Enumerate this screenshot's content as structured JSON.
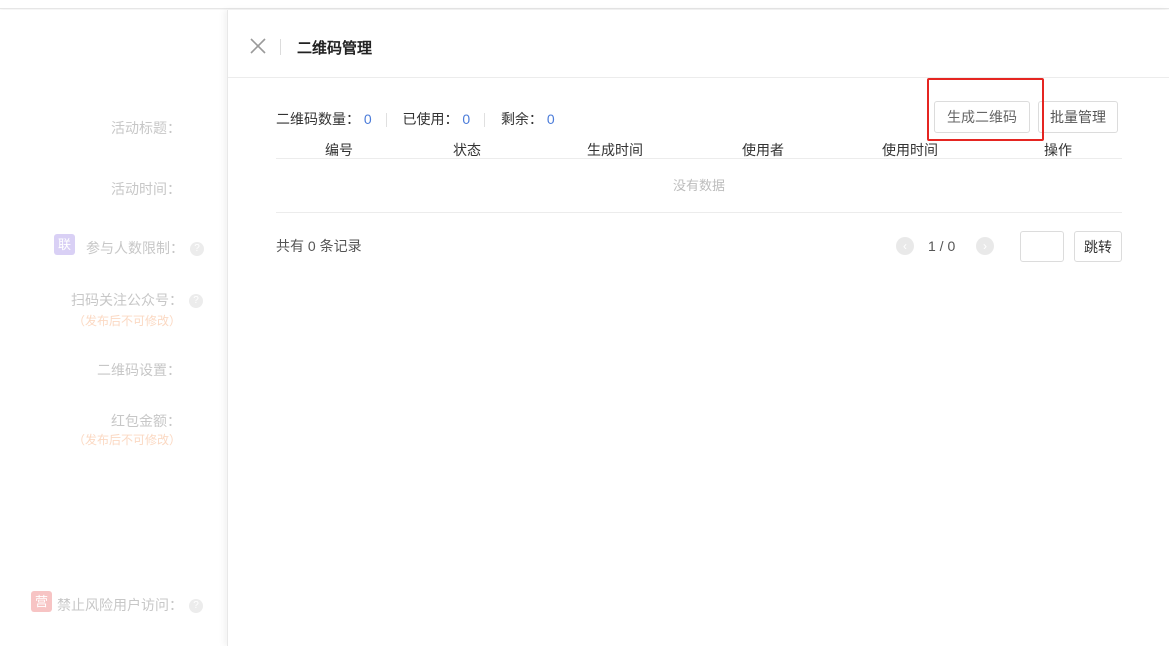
{
  "form": {
    "activity_title": "活动标题：",
    "activity_time": "活动时间：",
    "participant_limit": "参与人数限制：",
    "participant_badge": "联",
    "scan_follow": "扫码关注公众号：",
    "scan_follow_note": "（发布后不可修改）",
    "qr_settings": "二维码设置：",
    "red_packet": "红包金额：",
    "red_packet_note": "（发布后不可修改）",
    "risk_block": "禁止风险用户访问：",
    "risk_badge": "营",
    "help_glyph": "?"
  },
  "drawer": {
    "title": "二维码管理",
    "stats": {
      "count_label": "二维码数量：",
      "count_value": "0",
      "used_label": "已使用：",
      "used_value": "0",
      "remain_label": "剩余：",
      "remain_value": "0"
    },
    "buttons": {
      "generate": "生成二维码",
      "batch": "批量管理"
    },
    "table": {
      "columns": [
        "编号",
        "状态",
        "生成时间",
        "使用者",
        "使用时间",
        "操作"
      ],
      "empty_text": "没有数据"
    },
    "pagination": {
      "total_text": "共有 0 条记录",
      "page_info": "1 / 0",
      "prev_glyph": "‹",
      "next_glyph": "›",
      "jump_value": "",
      "jump_label": "跳转"
    }
  },
  "colors": {
    "accent_blue": "#4a7bd9",
    "highlight_red": "#e52521",
    "badge_purple": "#d9d0f5",
    "badge_red": "#f7c4c4"
  }
}
